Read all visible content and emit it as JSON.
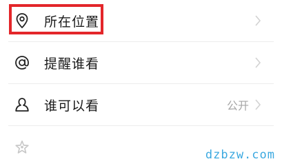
{
  "menu": {
    "location": {
      "label": "所在位置",
      "icon": "location-pin-icon"
    },
    "remind": {
      "label": "提醒谁看",
      "icon": "at-sign-icon"
    },
    "visibility": {
      "label": "谁可以看",
      "value": "公开",
      "icon": "person-icon"
    },
    "partial": {
      "icon": "star-person-icon"
    }
  },
  "watermark": {
    "text": "dzbzw.com"
  },
  "colors": {
    "highlight": "#e3262a",
    "text": "#1a1a1a",
    "secondary": "#a6a6a6",
    "watermark": "#3aa8e0"
  }
}
